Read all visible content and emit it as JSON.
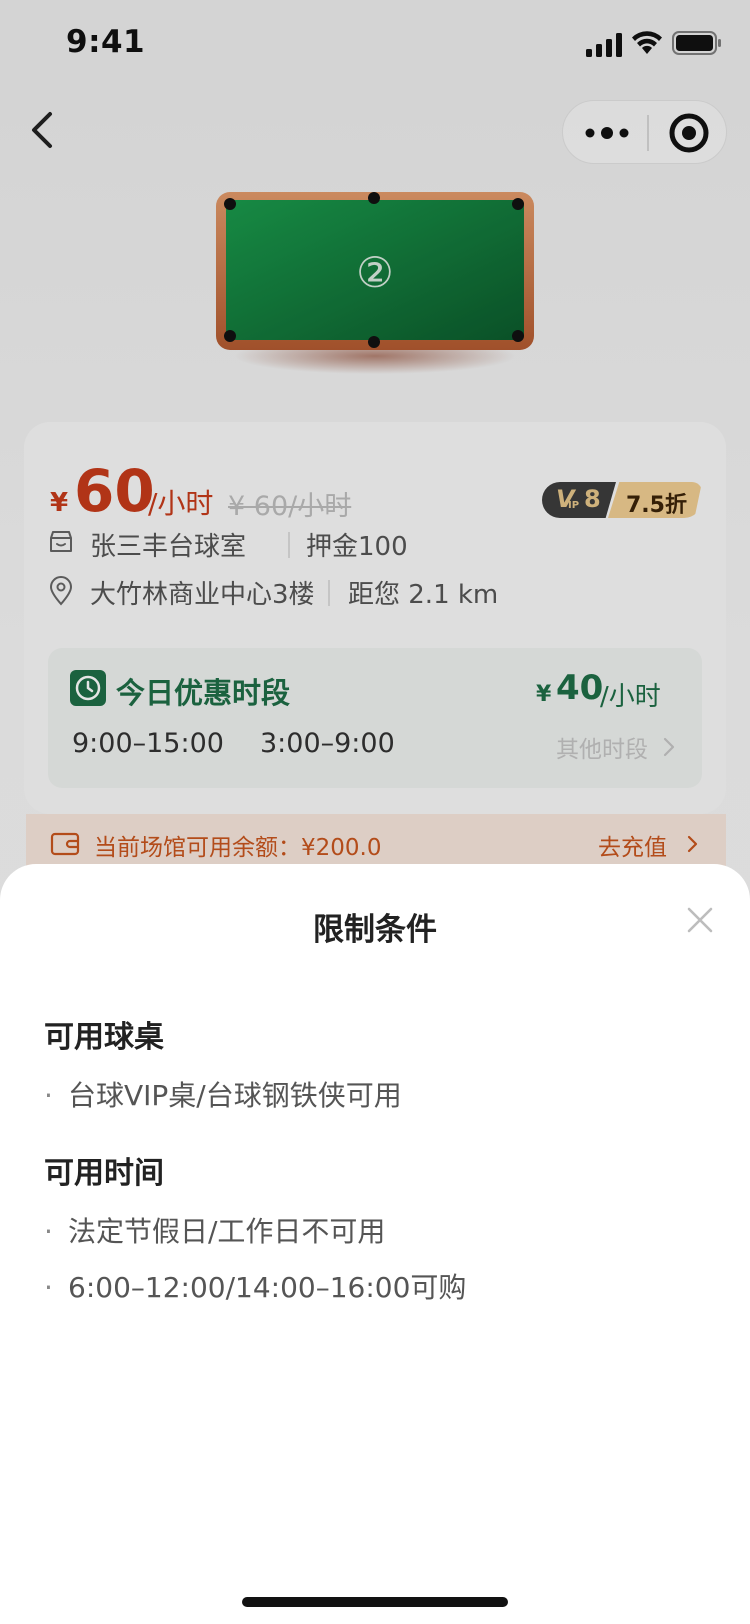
{
  "status_bar": {
    "time": "9:41"
  },
  "venue": {
    "table_number": "②",
    "price": {
      "currency": "¥",
      "value": "60",
      "unit": "/小时",
      "original": "¥ 60/小时"
    },
    "vip": {
      "mark": "V",
      "sub": "IP",
      "level": "8",
      "discount": "7.5折"
    },
    "name": "张三丰台球室",
    "deposit": "押金100",
    "address": "大竹林商业中心3楼",
    "distance": "距您 2.1 km"
  },
  "discount": {
    "title": "今日优惠时段",
    "price_currency": "¥",
    "price_value": "40",
    "price_unit": "/小时",
    "slots": [
      "9:00–15:00",
      "3:00–9:00"
    ],
    "other_label": "其他时段"
  },
  "balance": {
    "text": "当前场馆可用余额：¥200.0",
    "recharge_label": "去充值"
  },
  "sheet": {
    "title": "限制条件",
    "sections": [
      {
        "title": "可用球桌",
        "items": [
          "台球VIP桌/台球钢铁侠可用"
        ]
      },
      {
        "title": "可用时间",
        "items": [
          "法定节假日/工作日不可用",
          "6:00–12:00/14:00–16:00可购"
        ]
      }
    ]
  },
  "colors": {
    "price_red": "#c63a1a",
    "discount_green": "#1f6e47",
    "balance_orange": "#c8551e",
    "vip_gold": "#f0cd92"
  }
}
